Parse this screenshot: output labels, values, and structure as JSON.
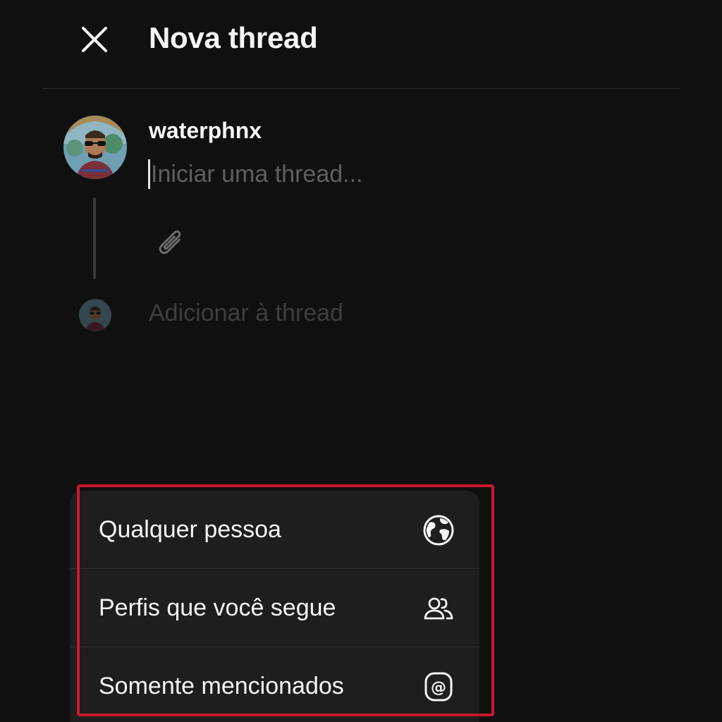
{
  "header": {
    "title": "Nova thread",
    "close_icon": "close-icon"
  },
  "composer": {
    "username": "waterphnx",
    "input_value": "",
    "input_placeholder": "Iniciar uma thread...",
    "attach_icon": "paperclip-icon",
    "add_to_thread_label": "Adicionar à thread"
  },
  "audience_menu": {
    "items": [
      {
        "label": "Qualquer pessoa",
        "icon": "globe-icon"
      },
      {
        "label": "Perfis que você segue",
        "icon": "people-icon"
      },
      {
        "label": "Somente mencionados",
        "icon": "at-sign-icon"
      }
    ]
  },
  "colors": {
    "background": "#101010",
    "menu_background": "#1e1e1e",
    "text_primary": "#f3f5f7",
    "placeholder": "#5f5f5f",
    "highlight": "#c8192c"
  }
}
